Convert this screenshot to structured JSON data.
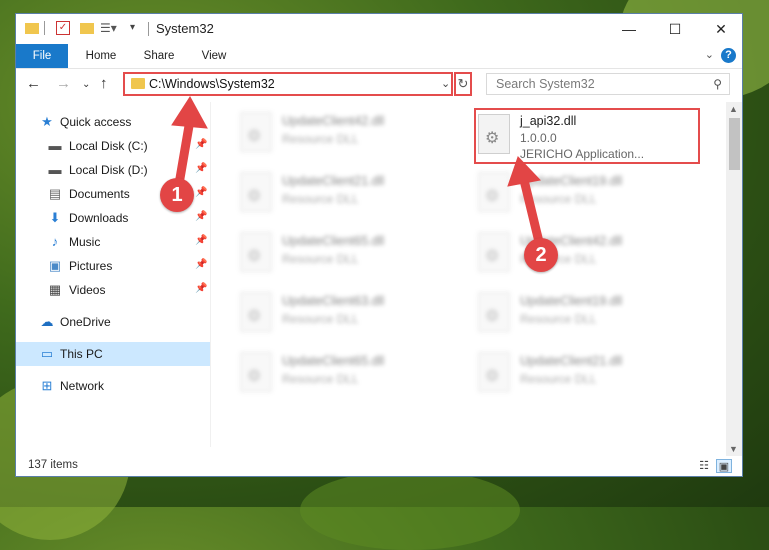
{
  "window": {
    "title": "System32"
  },
  "ribbon": {
    "tabs": [
      "File",
      "Home",
      "Share",
      "View"
    ],
    "help": "?"
  },
  "nav": {
    "address": "C:\\Windows\\System32",
    "search_placeholder": "Search System32"
  },
  "sidebar": {
    "items": [
      {
        "label": "Quick access",
        "icon": "star-icon",
        "pinned": false
      },
      {
        "label": "Local Disk (C:)",
        "icon": "drive-icon",
        "pinned": true
      },
      {
        "label": "Local Disk (D:)",
        "icon": "drive-icon",
        "pinned": true
      },
      {
        "label": "Documents",
        "icon": "documents-icon",
        "pinned": true
      },
      {
        "label": "Downloads",
        "icon": "download-icon",
        "pinned": true
      },
      {
        "label": "Music",
        "icon": "music-icon",
        "pinned": true
      },
      {
        "label": "Pictures",
        "icon": "pictures-icon",
        "pinned": true
      },
      {
        "label": "Videos",
        "icon": "videos-icon",
        "pinned": true
      },
      {
        "label": "OneDrive",
        "icon": "cloud-icon",
        "pinned": false
      },
      {
        "label": "This PC",
        "icon": "computer-icon",
        "pinned": false,
        "selected": true
      },
      {
        "label": "Network",
        "icon": "network-icon",
        "pinned": false
      }
    ]
  },
  "files": {
    "highlighted": {
      "name": "j_api32.dll",
      "version": "1.0.0.0",
      "description": "JERICHO Application..."
    },
    "items": [
      {
        "name": "UpdateClient42.dll",
        "type": "Resource DLL"
      },
      {
        "name": "UpdateClient21.dll",
        "type": "Resource DLL"
      },
      {
        "name": "UpdateClient19.dll",
        "type": "Resource DLL"
      },
      {
        "name": "UpdateClient65.dll",
        "type": "Resource DLL"
      },
      {
        "name": "UpdateClient42.dll",
        "type": "Resource DLL"
      },
      {
        "name": "UpdateClient63.dll",
        "type": "Resource DLL"
      },
      {
        "name": "UpdateClient19.dll",
        "type": "Resource DLL"
      },
      {
        "name": "UpdateClient65.dll",
        "type": "Resource DLL"
      },
      {
        "name": "UpdateClient21.dll",
        "type": "Resource DLL"
      }
    ]
  },
  "status": {
    "count": "137 items"
  },
  "annotations": {
    "step1": "1",
    "step2": "2",
    "color": "#e24545"
  }
}
